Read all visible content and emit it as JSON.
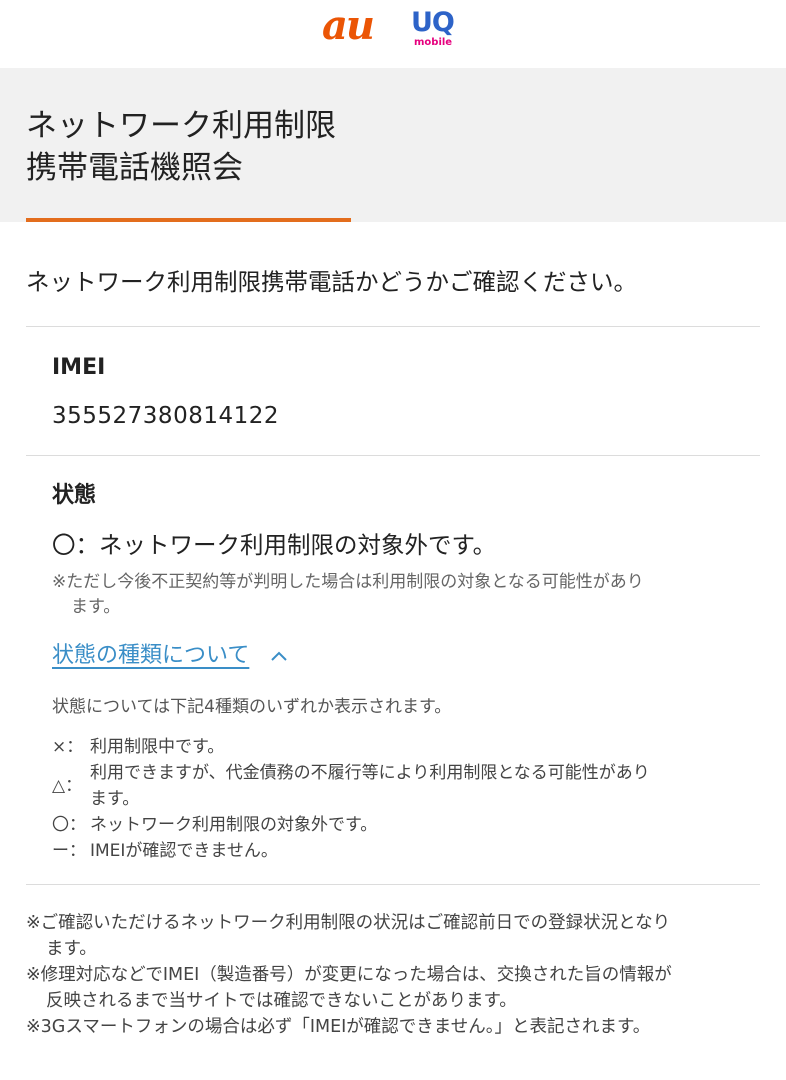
{
  "brand": {
    "au_logo": "au",
    "uq_logo": "UQ",
    "uq_logo_sub": "mobile",
    "au_color": "#eb5505",
    "uq_color": "#2d63c8",
    "uq_sub_color": "#e6007e"
  },
  "page": {
    "title_line1": "ネットワーク利用制限",
    "title_line2": "携帯電話機照会",
    "intro": "ネットワーク利用制限携帯電話かどうかご確認ください。",
    "accent_color": "#e36d1d"
  },
  "imei": {
    "label": "IMEI",
    "value": "355527380814122"
  },
  "status": {
    "label": "状態",
    "result": "〇：ネットワーク利用制限の対象外です。",
    "note_line1": "※ただし今後不正契約等が判明した場合は利用制限の対象となる可能性があり",
    "note_line2": "ます。",
    "types_link": "状態の種類について",
    "types_link_icon": "chevron-up-icon",
    "types_desc": "状態については下記4種類のいずれか表示されます。",
    "types": [
      {
        "symbol": "×：",
        "text": "利用制限中です。"
      },
      {
        "symbol": "△：",
        "text": "利用できますが、代金債務の不履行等により利用制限となる可能性があり",
        "text2": "ます。"
      },
      {
        "symbol": "〇：",
        "text": "ネットワーク利用制限の対象外です。"
      },
      {
        "symbol": "ー：",
        "text": "IMEIが確認できません。"
      }
    ]
  },
  "footer_notes": {
    "n1_line1": "※ご確認いただけるネットワーク利用制限の状況はご確認前日での登録状況となり",
    "n1_line2": "ます。",
    "n2_line1": "※修理対応などでIMEI（製造番号）が変更になった場合は、交換された旨の情報が",
    "n2_line2": "反映されるまで当サイトでは確認できないことがあります。",
    "n3": "※3Gスマートフォンの場合は必ず「IMEIが確認できません。」と表記されます。"
  }
}
